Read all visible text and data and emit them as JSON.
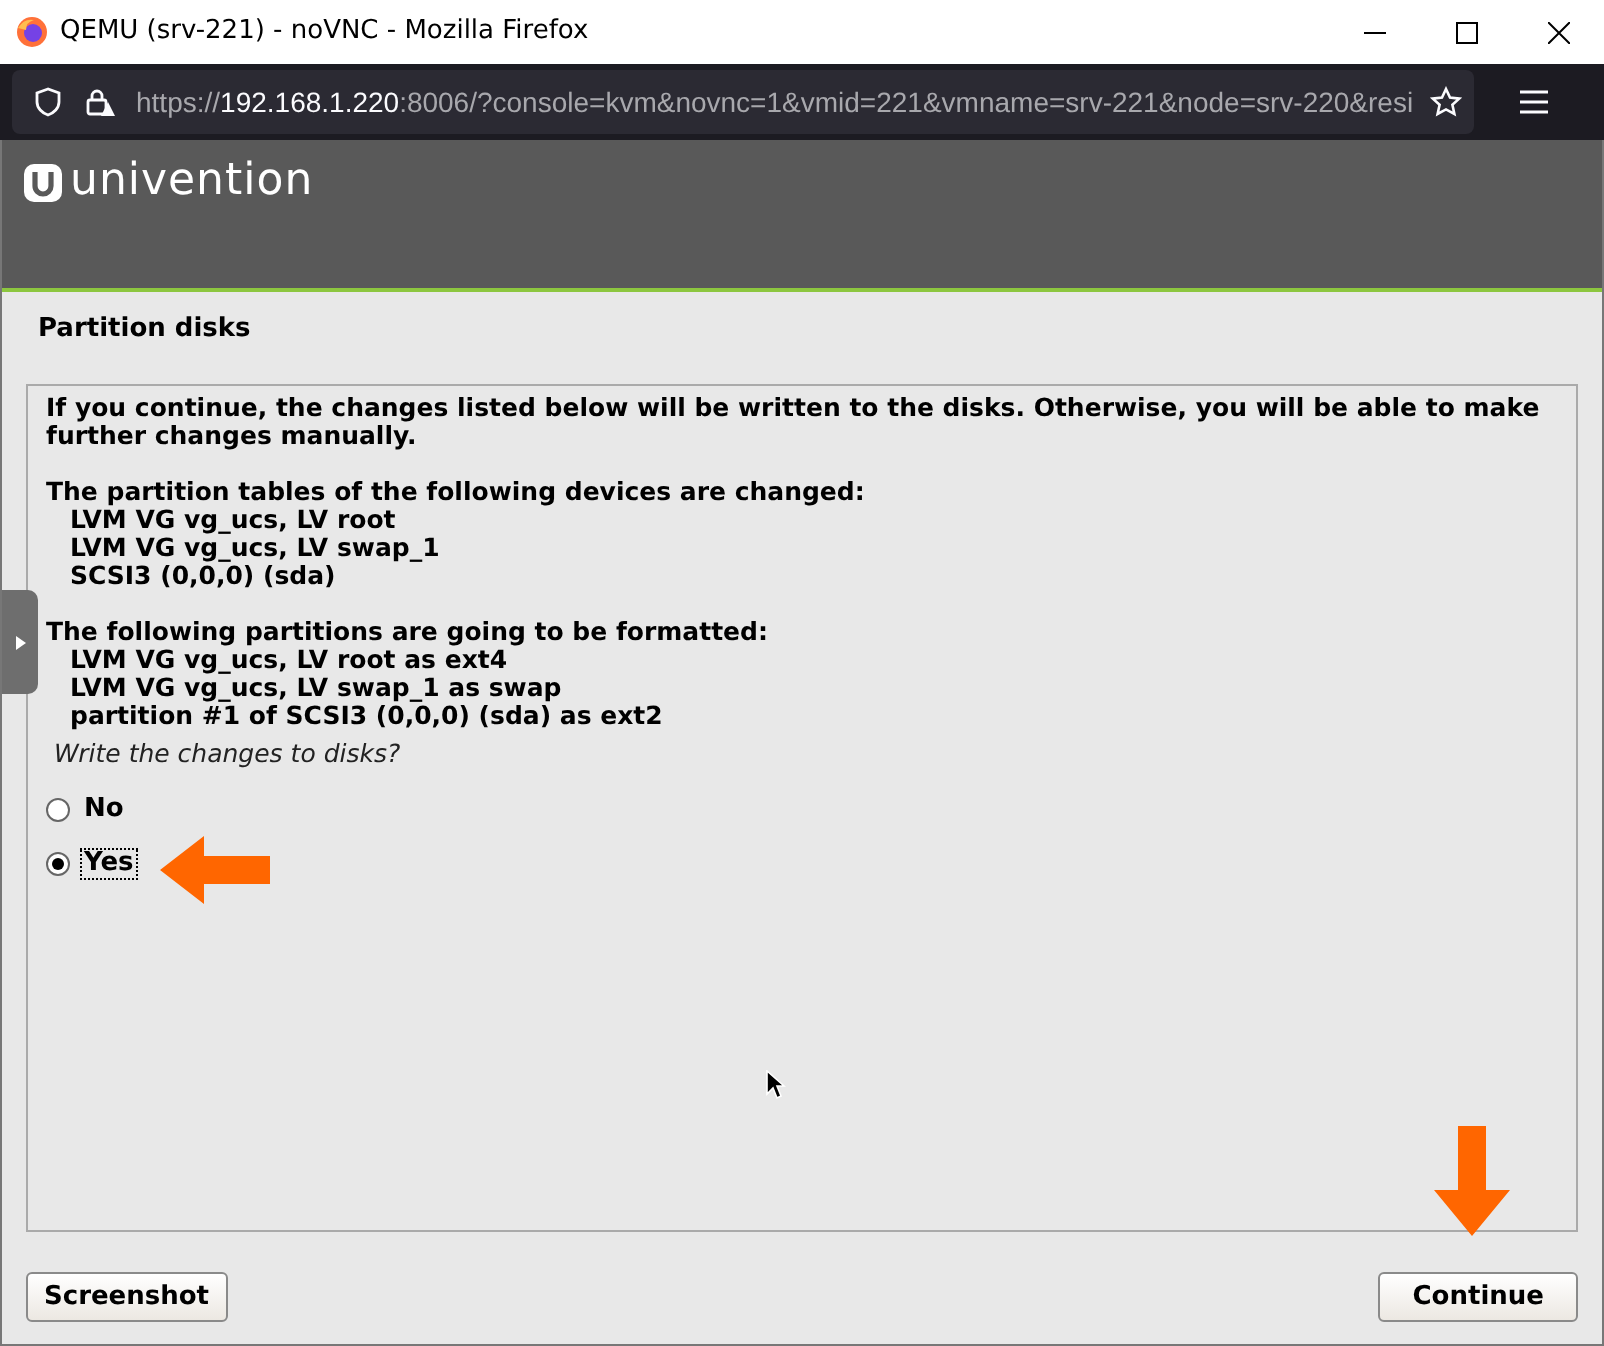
{
  "window": {
    "title": "QEMU (srv-221) - noVNC - Mozilla Firefox"
  },
  "address_bar": {
    "scheme": "https://",
    "host": "192.168.1.220",
    "rest": ":8006/?console=kvm&novnc=1&vmid=221&vmname=srv-221&node=srv-220&resi"
  },
  "installer": {
    "logo": "univention",
    "section_title": "Partition disks",
    "intro": "If you continue, the changes listed below will be written to the disks. Otherwise, you will be able to make further changes manually.",
    "groups": [
      {
        "heading": "The partition tables of the following devices are changed:",
        "items": [
          "LVM VG vg_ucs, LV root",
          "LVM VG vg_ucs, LV swap_1",
          "SCSI3 (0,0,0) (sda)"
        ]
      },
      {
        "heading": "The following partitions are going to be formatted:",
        "items": [
          "LVM VG vg_ucs, LV root as ext4",
          "LVM VG vg_ucs, LV swap_1 as swap",
          "partition #1 of SCSI3 (0,0,0) (sda) as ext2"
        ]
      }
    ],
    "question": "Write the changes to disks?",
    "options": [
      {
        "label": "No",
        "selected": false
      },
      {
        "label": "Yes",
        "selected": true
      }
    ],
    "buttons": [
      {
        "label": "Screenshot"
      },
      {
        "label": "Continue"
      }
    ]
  }
}
